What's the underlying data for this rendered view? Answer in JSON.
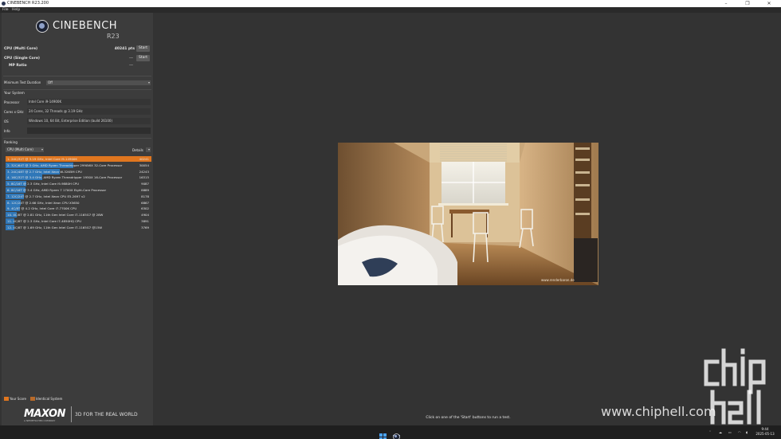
{
  "window": {
    "title": "CINEBENCH R23.200"
  },
  "menu": {
    "file": "File",
    "help": "Help"
  },
  "logo": {
    "name": "CINEBENCH",
    "version": "R23"
  },
  "tests": {
    "multi": {
      "label": "CPU (Multi Core)",
      "value": "40241 pts",
      "button": "Start"
    },
    "single": {
      "label": "CPU (Single Core)",
      "value": "---",
      "button": "Start"
    },
    "ratio": {
      "label": "MP Ratio",
      "value": "---"
    }
  },
  "min_duration": {
    "label": "Minimum Test Duration",
    "value": "Off"
  },
  "system": {
    "heading": "Your System",
    "processor": {
      "label": "Processor",
      "value": "Intel Core i9-14900K"
    },
    "cores": {
      "label": "Cores x GHz",
      "value": "24 Cores, 32 Threads @ 3.19 GHz"
    },
    "os": {
      "label": "OS",
      "value": "Windows 10, 64 Bit, Enterprise Edition (build 26100)"
    },
    "info": {
      "label": "Info",
      "value": ""
    }
  },
  "ranking": {
    "heading": "Ranking",
    "filter": "CPU (Multi Core)",
    "details": "Details",
    "rows": [
      {
        "name": "1. 24C/32T @ 3.19 GHz, Intel Core i9-14900K",
        "score": "40241",
        "mine": true,
        "fraction": 1.0
      },
      {
        "name": "2. 32C/64T @ 3 GHz, AMD Ryzen Threadripper 2990WX 32-Core Processor",
        "score": "30054",
        "mine": false,
        "fraction": 0.747
      },
      {
        "name": "3. 24C/48T @ 2.7 GHz, Intel Xeon W-3265M CPU",
        "score": "24243",
        "mine": false,
        "fraction": 0.602
      },
      {
        "name": "4. 16C/32T @ 3.4 GHz, AMD Ryzen Threadripper 1950X 16-Core Processor",
        "score": "16315",
        "mine": false,
        "fraction": 0.405
      },
      {
        "name": "5. 8C/16T @ 2.3 GHz, Intel Core i9-9880H CPU",
        "score": "9087",
        "mine": false,
        "fraction": 0.226
      },
      {
        "name": "6. 8C/16T @ 3.4 GHz, AMD Ryzen 7 1700X Eight-Core Processor",
        "score": "8889",
        "mine": false,
        "fraction": 0.221
      },
      {
        "name": "7. 12C/24T @ 2.7 GHz, Intel Xeon CPU E5-2697 v2",
        "score": "8178",
        "mine": false,
        "fraction": 0.203
      },
      {
        "name": "8. 12C/24T @ 2.66 GHz, Intel Xeon CPU X5650",
        "score": "6867",
        "mine": false,
        "fraction": 0.171
      },
      {
        "name": "9. 4C/8T @ 4.2 GHz, Intel Core i7-7700K CPU",
        "score": "6302",
        "mine": false,
        "fraction": 0.157
      },
      {
        "name": "10. 4C/8T @ 2.81 GHz, 11th Gen Intel Core i7-1165G7 @ 28W",
        "score": "4904",
        "mine": false,
        "fraction": 0.122
      },
      {
        "name": "11. 4C/8T @ 2.3 GHz, Intel Core i7-4850HQ CPU",
        "score": "3891",
        "mine": false,
        "fraction": 0.097
      },
      {
        "name": "12. 4C/8T @ 1.69 GHz, 11th Gen Intel Core i7-1165G7 @15W",
        "score": "3769",
        "mine": false,
        "fraction": 0.094
      }
    ]
  },
  "legend": {
    "your_score": "Your Score",
    "identical": "Identical System"
  },
  "branding": {
    "maxon": "MAXON",
    "maxon_sub": "A NEMETSCHEK COMPANY",
    "tagline": "3D FOR THE REAL WORLD"
  },
  "status": "Click on one of the 'Start' buttons to run a test.",
  "render_credit": "www.renderbaron.de",
  "watermark": {
    "logo": "chip hell",
    "url": "www.chiphell.com"
  },
  "taskbar": {
    "time": "9:44",
    "date": "2025-05-13"
  },
  "colors": {
    "my_score": "#e0761f",
    "other_score": "#2f77b8",
    "panel": "#3c3c3c",
    "background": "#333333"
  }
}
